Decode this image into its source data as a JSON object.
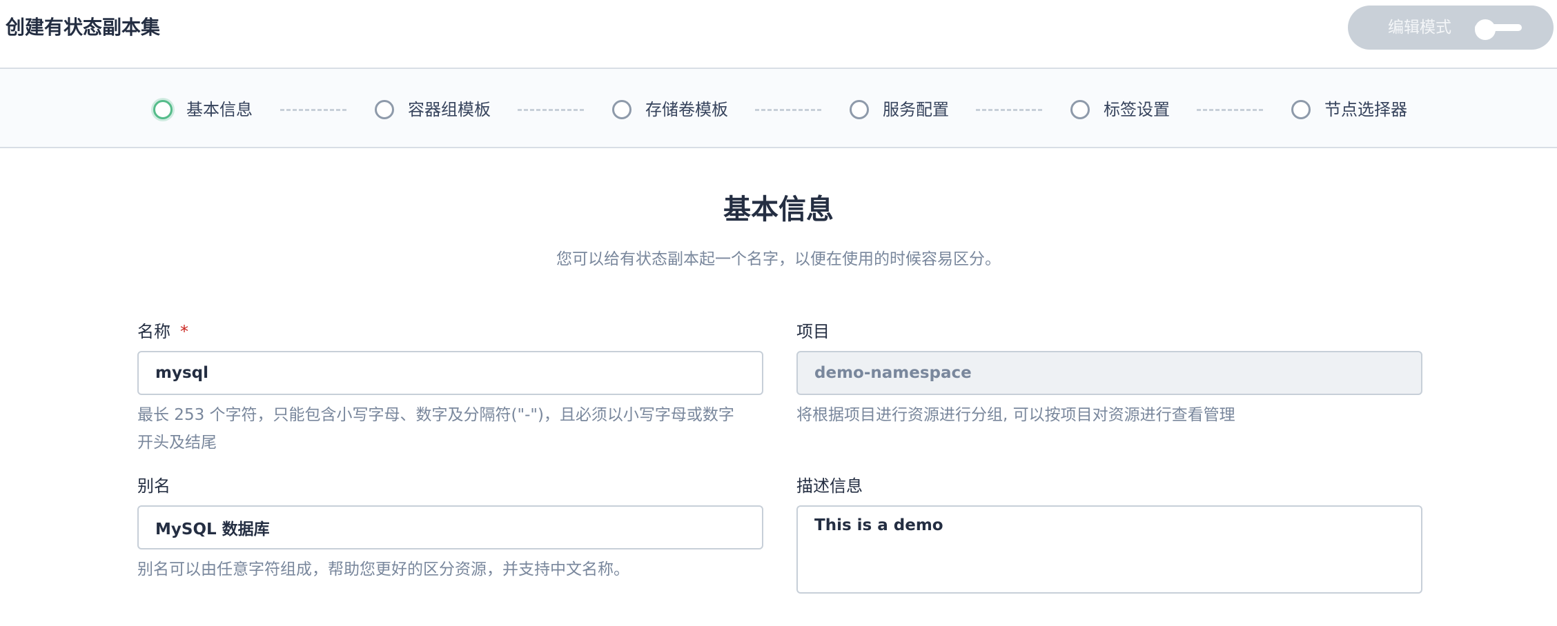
{
  "header": {
    "title": "创建有状态副本集",
    "edit_mode": {
      "label": "编辑模式",
      "enabled": false
    }
  },
  "steps": [
    {
      "label": "基本信息",
      "active": true
    },
    {
      "label": "容器组模板",
      "active": false
    },
    {
      "label": "存储卷模板",
      "active": false
    },
    {
      "label": "服务配置",
      "active": false
    },
    {
      "label": "标签设置",
      "active": false
    },
    {
      "label": "节点选择器",
      "active": false
    }
  ],
  "section": {
    "title": "基本信息",
    "description": "您可以给有状态副本起一个名字，以便在使用的时候容易区分。"
  },
  "form": {
    "name": {
      "label": "名称",
      "required_mark": "*",
      "value": "mysql",
      "description_line1": "最长 253 个字符，只能包含小写字母、数字及分隔符(\"-\")，且必须以小写字母或数字",
      "description_line2": "开头及结尾"
    },
    "project": {
      "label": "项目",
      "value": "demo-namespace",
      "description": "将根据项目进行资源进行分组, 可以按项目对资源进行查看管理"
    },
    "alias": {
      "label": "别名",
      "value": "MySQL 数据库",
      "description": "别名可以由任意字符组成，帮助您更好的区分资源，并支持中文名称。"
    },
    "description": {
      "label": "描述信息",
      "value": "This is a demo"
    }
  },
  "colors": {
    "active_step": "#55bc8a",
    "inactive_step": "#8e9aaa",
    "toggle_bg": "#c9d0d8",
    "required": "#ca2621"
  }
}
